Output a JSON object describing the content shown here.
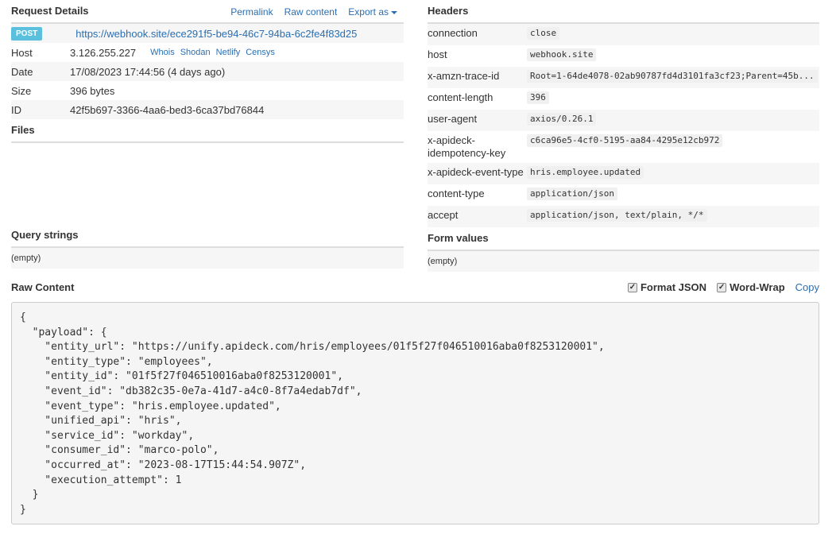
{
  "request": {
    "title": "Request Details",
    "links": {
      "permalink": "Permalink",
      "raw": "Raw content",
      "export": "Export as"
    },
    "method": "POST",
    "url": "https://webhook.site/ece291f5-be94-46c7-94ba-6c2fe4f83d25",
    "rows": [
      {
        "key": "Host",
        "value": "3.126.255.227"
      },
      {
        "key": "Date",
        "value": "17/08/2023 17:44:56 (4 days ago)"
      },
      {
        "key": "Size",
        "value": "396 bytes"
      },
      {
        "key": "ID",
        "value": "42f5b697-3366-4aa6-bed3-6ca37bd76844"
      }
    ],
    "host_links": [
      "Whois",
      "Shodan",
      "Netlify",
      "Censys"
    ]
  },
  "files": {
    "title": "Files"
  },
  "headers": {
    "title": "Headers",
    "items": [
      {
        "key": "connection",
        "value": "close"
      },
      {
        "key": "host",
        "value": "webhook.site"
      },
      {
        "key": "x-amzn-trace-id",
        "value": "Root=1-64de4078-02ab90787fd4d3101fa3cf23;Parent=45b..."
      },
      {
        "key": "content-length",
        "value": "396"
      },
      {
        "key": "user-agent",
        "value": "axios/0.26.1"
      },
      {
        "key": "x-apideck-idempotency-key",
        "value": "c6ca96e5-4cf0-5195-aa84-4295e12cb972"
      },
      {
        "key": "x-apideck-event-type",
        "value": "hris.employee.updated"
      },
      {
        "key": "content-type",
        "value": "application/json"
      },
      {
        "key": "accept",
        "value": "application/json, text/plain, */*"
      }
    ]
  },
  "query_strings": {
    "title": "Query strings",
    "value": "(empty)"
  },
  "form_values": {
    "title": "Form values",
    "value": "(empty)"
  },
  "raw": {
    "title": "Raw Content",
    "format_json_label": "Format JSON",
    "format_json_checked": true,
    "word_wrap_label": "Word-Wrap",
    "word_wrap_checked": true,
    "copy_label": "Copy",
    "content": "{\n  \"payload\": {\n    \"entity_url\": \"https://unify.apideck.com/hris/employees/01f5f27f046510016aba0f8253120001\",\n    \"entity_type\": \"employees\",\n    \"entity_id\": \"01f5f27f046510016aba0f8253120001\",\n    \"event_id\": \"db382c35-0e7a-41d7-a4c0-8f7a4edab7df\",\n    \"event_type\": \"hris.employee.updated\",\n    \"unified_api\": \"hris\",\n    \"service_id\": \"workday\",\n    \"consumer_id\": \"marco-polo\",\n    \"occurred_at\": \"2023-08-17T15:44:54.907Z\",\n    \"execution_attempt\": 1\n  }\n}"
  },
  "colors": {
    "link": "#2a6fb3",
    "badge": "#5bc0de",
    "stripe": "#f6f6f6"
  }
}
